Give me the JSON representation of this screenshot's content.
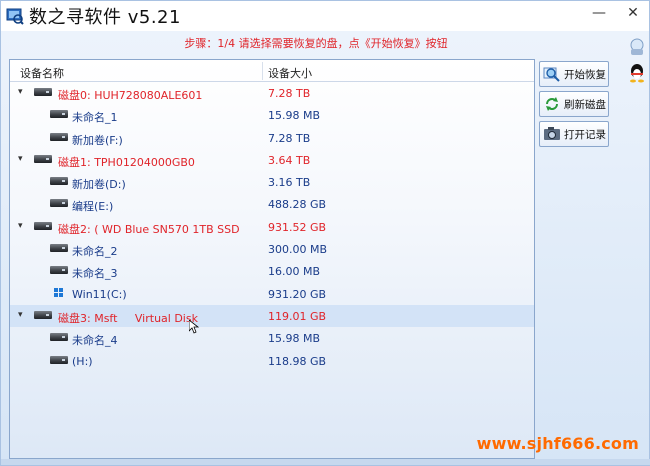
{
  "window": {
    "title": "数之寻软件 v5.21",
    "minimize": "—",
    "close": "✕"
  },
  "step_text": "步骤：1/4 请选择需要恢复的盘，点《开始恢复》按钮",
  "list": {
    "col_name": "设备名称",
    "col_size": "设备大小",
    "rows": [
      {
        "type": "disk",
        "name": "磁盘0: HUH728080ALE601",
        "size": "7.28 TB"
      },
      {
        "type": "part",
        "name": "未命名_1",
        "size": "15.98 MB"
      },
      {
        "type": "part",
        "name": "新加卷(F:)",
        "size": "7.28 TB"
      },
      {
        "type": "disk",
        "name": "磁盘1: TPH01204000GB0",
        "size": "3.64 TB"
      },
      {
        "type": "part",
        "name": "新加卷(D:)",
        "size": "3.16 TB"
      },
      {
        "type": "part",
        "name": "编程(E:)",
        "size": "488.28 GB"
      },
      {
        "type": "disk",
        "name": "磁盘2: ( WD Blue SN570 1TB SSD",
        "size": "931.52 GB"
      },
      {
        "type": "part",
        "name": "未命名_2",
        "size": "300.00 MB"
      },
      {
        "type": "part",
        "name": "未命名_3",
        "size": "16.00 MB"
      },
      {
        "type": "part",
        "name": "Win11(C:)",
        "size": "931.20 GB"
      },
      {
        "type": "disk",
        "name": "磁盘3: Msft     Virtual Disk",
        "size": "119.01 GB"
      },
      {
        "type": "part",
        "name": "未命名_4",
        "size": "15.98 MB"
      },
      {
        "type": "part",
        "name": "(H:)",
        "size": "118.98 GB"
      }
    ]
  },
  "buttons": {
    "start_recovery": "开始恢复",
    "refresh_disk": "刷新磁盘",
    "open_record": "打开记录"
  },
  "watermark": "www.sjhf666.com",
  "colors": {
    "accent_red": "#e0242a",
    "partition_blue": "#1a3c8a",
    "watermark_orange": "#ff6a00"
  }
}
